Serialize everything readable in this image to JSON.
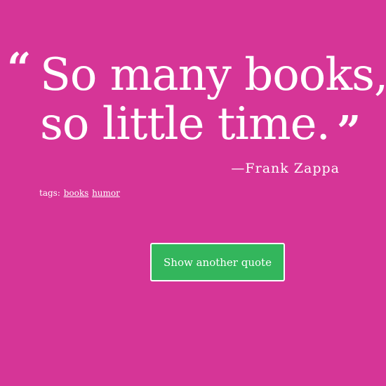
{
  "quote": {
    "open_mark": "“",
    "lines": [
      "So many books,",
      "so little time."
    ],
    "close_mark": "”",
    "author": "—Frank Zappa"
  },
  "tags": {
    "label": "tags:",
    "items": [
      "books",
      "humor"
    ]
  },
  "actions": {
    "another_label": "Show another quote"
  },
  "colors": {
    "background": "#d63597",
    "button": "#33b65c",
    "text": "#ffffff"
  }
}
